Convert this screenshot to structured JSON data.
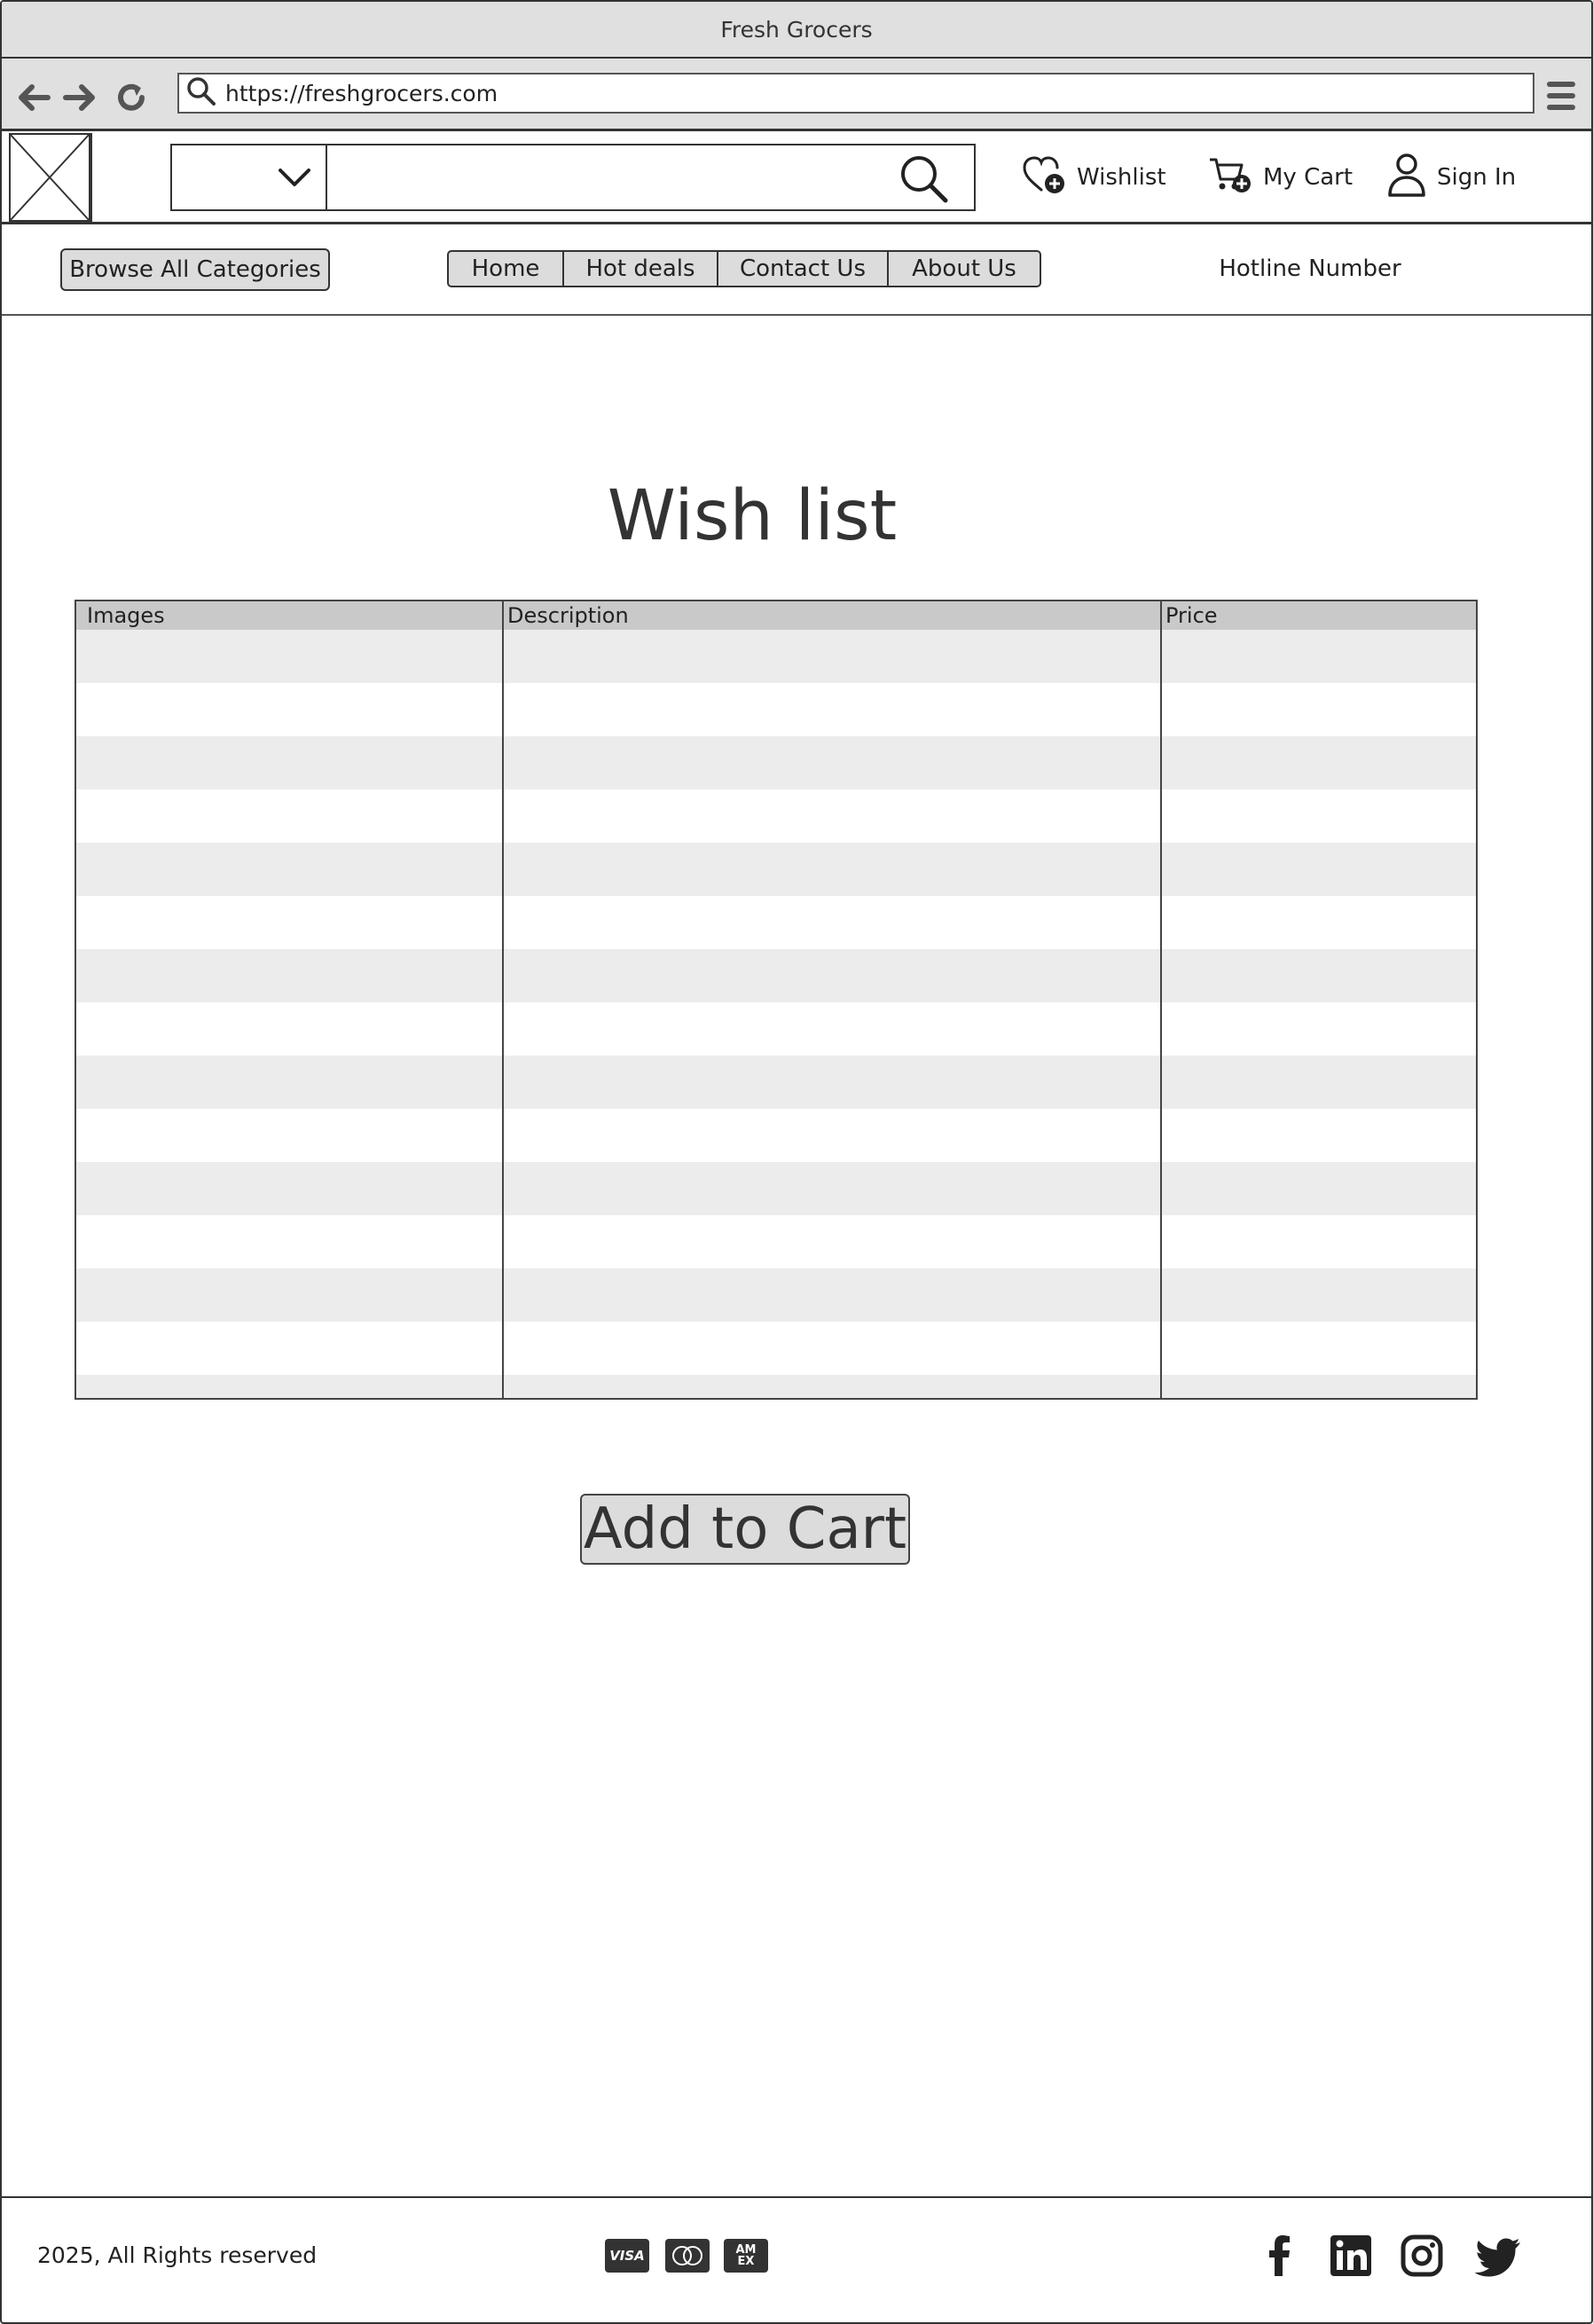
{
  "window": {
    "title": "Fresh Grocers",
    "url": "https://freshgrocers.com"
  },
  "header": {
    "category_selected": "",
    "search_value": "",
    "wishlist_label": "Wishlist",
    "cart_label": "My Cart",
    "signin_label": "Sign In"
  },
  "nav": {
    "browse_label": "Browse All Categories",
    "tabs": [
      {
        "label": "Home"
      },
      {
        "label": "Hot deals"
      },
      {
        "label": "Contact Us"
      },
      {
        "label": "About Us"
      }
    ],
    "hotline_label": "Hotline Number"
  },
  "main": {
    "title": "Wish list",
    "table": {
      "columns": [
        "Images",
        "Description",
        "Price"
      ],
      "rows": [
        [
          "",
          "",
          ""
        ],
        [
          "",
          "",
          ""
        ],
        [
          "",
          "",
          ""
        ],
        [
          "",
          "",
          ""
        ],
        [
          "",
          "",
          ""
        ],
        [
          "",
          "",
          ""
        ],
        [
          "",
          "",
          ""
        ],
        [
          "",
          "",
          ""
        ],
        [
          "",
          "",
          ""
        ],
        [
          "",
          "",
          ""
        ],
        [
          "",
          "",
          ""
        ],
        [
          "",
          "",
          ""
        ],
        [
          "",
          "",
          ""
        ],
        [
          "",
          "",
          ""
        ],
        [
          "",
          "",
          ""
        ]
      ]
    },
    "add_to_cart_label": "Add to Cart"
  },
  "footer": {
    "copyright": "2025, All Rights reserved",
    "payment_icons": [
      "visa-icon",
      "mastercard-icon",
      "amex-icon"
    ],
    "payment_text": {
      "visa": "VISA",
      "amex": "AM EX"
    },
    "social_icons": [
      "facebook-icon",
      "linkedin-icon",
      "instagram-icon",
      "twitter-icon"
    ]
  },
  "colors": {
    "chrome": "#e0e0e0",
    "button_fill": "#dcdcdc",
    "table_header": "#c9c9c9",
    "row_stripe": "#ececec",
    "ink": "#333333"
  }
}
